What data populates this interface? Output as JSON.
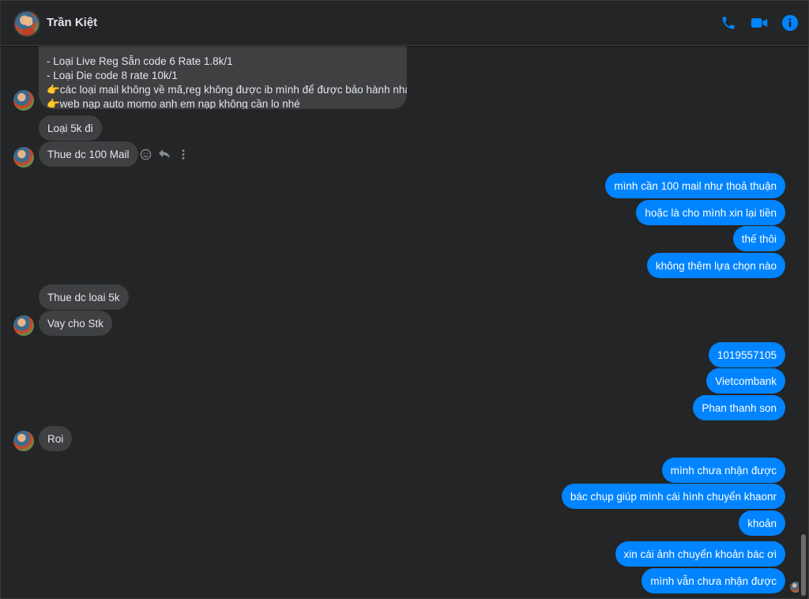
{
  "header": {
    "title": "Trần Kiệt",
    "icons": [
      "phone-icon",
      "video-camera-icon",
      "info-icon"
    ],
    "accent_color": "#0084ff"
  },
  "thread": {
    "pinned_message": {
      "cut_line": "…  …  …  …",
      "lines": [
        "- Loại Live Reg Sẵn code 6  Rate 1.8k/1",
        "- Loại Die code 8 rate 10k/1",
        "👉các loại mail không về mã,reg không được ib mình để được bảo hành nha",
        "👉web nạp auto momo anh em nạp không cần lo nhé"
      ]
    },
    "incoming": [
      "Loại 5k đi",
      "Thue dc 100 Mail",
      "Thue dc loai 5k",
      "Vay cho Stk",
      "Roi"
    ],
    "outgoing": [
      "mình cần 100 mail như thoả thuận",
      "hoặc là cho mình xin lại tiền",
      "thế thôi",
      "không thêm lựa chọn nào",
      "1019557105",
      "Vietcombank",
      "Phan thanh son",
      "mình chưa nhận được",
      "bác chụp giúp mình cái hình chuyển khaonr",
      "khoản",
      "xin cái ảnh chuyển khoản bác ơi",
      "mình vẫn chưa nhận được"
    ],
    "message_tools": [
      "emoji-reaction-icon",
      "reply-icon",
      "more-options-icon"
    ],
    "bubble_colors": {
      "incoming": "#3e4042",
      "outgoing": "#0084ff"
    }
  }
}
